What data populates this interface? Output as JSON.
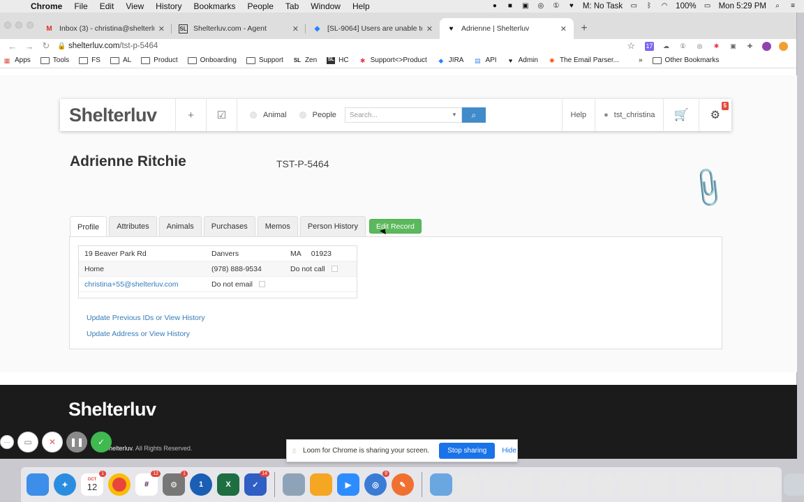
{
  "menubar": {
    "app": "Chrome",
    "items": [
      "File",
      "Edit",
      "View",
      "History",
      "Bookmarks",
      "People",
      "Tab",
      "Window",
      "Help"
    ],
    "task": "M: No Task",
    "battery": "100%",
    "clock": "Mon 5:29 PM"
  },
  "tabs": [
    {
      "title": "Inbox (3) - christina@shelterluv",
      "icon": "gmail-icon",
      "color": "#d93025",
      "glyph": "M"
    },
    {
      "title": "Shelterluv.com - Agent",
      "icon": "shelterluv-icon",
      "color": "#333333",
      "glyph": "SL"
    },
    {
      "title": "[SL-9064] Users are unable to",
      "icon": "jira-icon",
      "color": "#2684ff",
      "glyph": "◆"
    },
    {
      "title": "Adrienne | Shelterluv",
      "icon": "heart-icon",
      "color": "#111111",
      "glyph": "♥"
    }
  ],
  "address": {
    "host": "shelterluv.com",
    "path": "/tst-p-5464"
  },
  "bookmarks": [
    {
      "label": "Apps",
      "icon": "apps-grid-icon"
    },
    {
      "label": "Tools",
      "icon": "folder-icon"
    },
    {
      "label": "FS",
      "icon": "folder-icon"
    },
    {
      "label": "AL",
      "icon": "folder-icon"
    },
    {
      "label": "Product",
      "icon": "folder-icon"
    },
    {
      "label": "Onboarding",
      "icon": "folder-icon"
    },
    {
      "label": "Support",
      "icon": "folder-icon"
    },
    {
      "label": "Zen",
      "icon": "shelterluv-icon"
    },
    {
      "label": "HC",
      "icon": "shelterluv-icon"
    },
    {
      "label": "Support<>Product",
      "icon": "asana-icon"
    },
    {
      "label": "JIRA",
      "icon": "jira-icon"
    },
    {
      "label": "API",
      "icon": "doc-icon"
    },
    {
      "label": "Admin",
      "icon": "heart-icon"
    },
    {
      "label": "The Email Parser...",
      "icon": "zapier-icon"
    }
  ],
  "bookmarks_more": "»",
  "bookmarks_other": "Other Bookmarks",
  "nav": {
    "logo": "Shelterluv",
    "radio_animal": "Animal",
    "radio_people": "People",
    "search_placeholder": "Search...",
    "help": "Help",
    "user": "tst_christina",
    "notification_count": "5"
  },
  "person": {
    "name": "Adrienne Ritchie",
    "id": "TST-P-5464"
  },
  "profile_tabs": [
    "Profile",
    "Attributes",
    "Animals",
    "Purchases",
    "Memos",
    "Person History"
  ],
  "edit_button": "Edit Record",
  "contact": {
    "street": "19 Beaver Park Rd",
    "city": "Danvers",
    "state": "MA",
    "zip": "01923",
    "phone_type": "Home",
    "phone": "(978) 888-9534",
    "do_not_call": "Do not call",
    "email": "christina+55@shelterluv.com",
    "do_not_email": "Do not email"
  },
  "links": {
    "prev_ids": "Update Previous IDs or View History",
    "address": "Update Address or View History"
  },
  "footer": {
    "logo": "Shelterluv",
    "copyright_brand": "Shelterluv",
    "copyright_rest": ". All Rights Reserved."
  },
  "loom": {
    "message": "Loom for Chrome is sharing your screen.",
    "stop": "Stop sharing",
    "hide": "Hide"
  },
  "dock": {
    "calendar_date": "12",
    "calendar_month": "OCT",
    "badges": {
      "calendar": "1",
      "slack": "12",
      "prefs": "1",
      "tasks": "14",
      "zoom": "9"
    }
  }
}
